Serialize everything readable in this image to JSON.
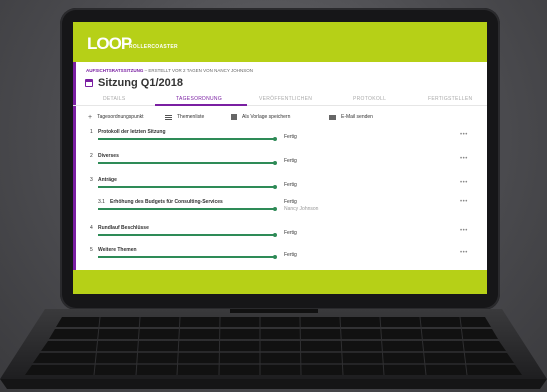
{
  "app": {
    "logo": "LOOP",
    "logo_sub": "ROLLERCOASTER",
    "accent": "#b6d017",
    "brand": "#7a1fa2"
  },
  "meeting": {
    "type": "AUFSICHTSRATSSITZUNG",
    "meta": " – ERSTELLT VOR 2 TAGEN VON NANCY JOHNSON",
    "title": "Sitzung Q1/2018"
  },
  "tabs": [
    {
      "label": "DETAILS",
      "active": false
    },
    {
      "label": "TAGESORDNUNG",
      "active": true
    },
    {
      "label": "VERÖFFENTLICHEN",
      "active": false
    },
    {
      "label": "PROTOKOLL",
      "active": false
    },
    {
      "label": "FERTIGSTELLEN",
      "active": false
    }
  ],
  "toolbar": {
    "add": {
      "label": "Tagesordnungspunkt",
      "icon": "plus-icon"
    },
    "list": {
      "label": "Themenliste",
      "icon": "list-icon"
    },
    "template": {
      "label": "Als Vorlage speichern",
      "icon": "save-icon"
    },
    "email": {
      "label": "E-Mail senden",
      "icon": "mail-icon"
    }
  },
  "agenda": [
    {
      "num": "1",
      "title": "Protokoll der letzten Sitzung",
      "status": "Fertig",
      "assignee": "",
      "progress": 1.0
    },
    {
      "num": "2",
      "title": "Diverses",
      "status": "Fertig",
      "assignee": "",
      "progress": 1.0
    },
    {
      "num": "3",
      "title": "Anträge",
      "status": "Fertig",
      "assignee": "",
      "progress": 1.0
    },
    {
      "num": "3.1",
      "title": "Erhöhung des Budgets für Consulting-Services",
      "status": "Fertig",
      "assignee": "Nancy Johnson",
      "progress": 1.0
    },
    {
      "num": "4",
      "title": "Rundlauf Beschlüsse",
      "status": "Fertig",
      "assignee": "",
      "progress": 1.0
    },
    {
      "num": "5",
      "title": "Weitere Themen",
      "status": "Fertig",
      "assignee": "",
      "progress": 1.0
    }
  ],
  "more_label": "•••"
}
